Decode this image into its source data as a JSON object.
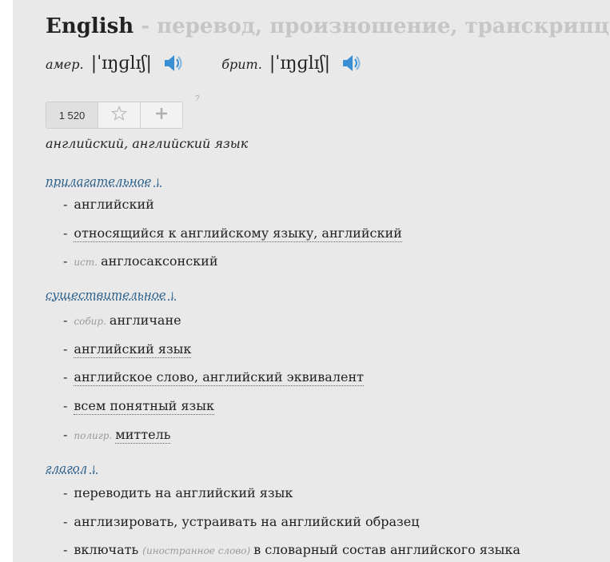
{
  "entry": {
    "word": "English",
    "subtitle": " - перевод, произношение, транскрипция"
  },
  "pronunciation": {
    "us_label": "амер.",
    "us_transcription": "|ˈɪŋɡlɪʃ|",
    "uk_label": "брит.",
    "uk_transcription": "|ˈɪŋɡlɪʃ|"
  },
  "rating": {
    "count": "1 520",
    "help": "?"
  },
  "summary": "английский, английский язык",
  "parts_of_speech": [
    {
      "heading": "прилагательное",
      "arrow": "↓",
      "meanings": [
        {
          "note": "",
          "text": "английский"
        },
        {
          "note": "",
          "text": "относящийся к английскому языку, английский"
        },
        {
          "note": "ист.",
          "text": "англосаксонский"
        }
      ]
    },
    {
      "heading": "существительное",
      "arrow": "↓",
      "meanings": [
        {
          "note": "собир.",
          "text": "англичане"
        },
        {
          "note": "",
          "text": "английский язык"
        },
        {
          "note": "",
          "text": "английское слово, английский эквивалент"
        },
        {
          "note": "",
          "text": "всем понятный язык"
        },
        {
          "note": "полигр.",
          "text": "миттель"
        }
      ]
    },
    {
      "heading": "глагол",
      "arrow": "↓",
      "meanings": [
        {
          "note": "",
          "text": "переводить на английский язык"
        },
        {
          "note": "",
          "text": "англизировать, устраивать на английский образец"
        },
        {
          "note": "",
          "text": "включать",
          "mid_note": "(иностранное слово)",
          "tail": "в словарный состав английского языка"
        }
      ]
    }
  ],
  "colors": {
    "link": "#2b5f8a",
    "muted_title": "#c6c6c6",
    "speaker": "#3a8fd4"
  }
}
